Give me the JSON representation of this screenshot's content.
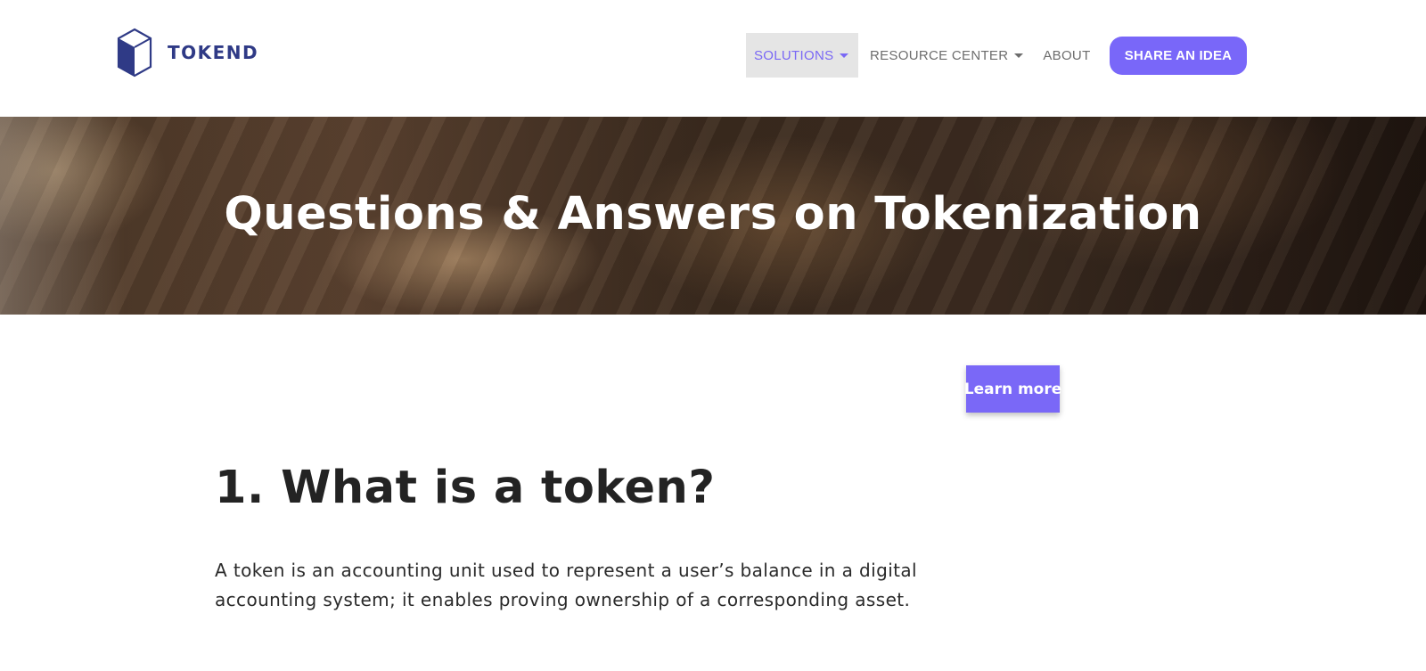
{
  "header": {
    "logo_text": "TOKEND",
    "nav": [
      {
        "label": "SOLUTIONS",
        "has_dropdown": true,
        "active": true
      },
      {
        "label": "RESOURCE CENTER",
        "has_dropdown": true,
        "active": false
      },
      {
        "label": "ABOUT",
        "has_dropdown": false,
        "active": false
      }
    ],
    "cta_label": "SHARE AN IDEA"
  },
  "hero": {
    "title": "Questions & Answers on Tokenization"
  },
  "main": {
    "learn_more_label": "Learn more",
    "question_title": "1. What is a token?",
    "question_body": "A token is an accounting unit used to represent a user’s balance in a digital accounting system; it enables proving ownership of a corresponding asset."
  },
  "colors": {
    "accent": "#7967f9",
    "brand": "#2f3a86",
    "nav_active_bg": "#e5e5e5",
    "text": "#232323"
  },
  "icons": {
    "logo": "hexagon-cube-icon",
    "dropdown": "caret-down-icon"
  }
}
